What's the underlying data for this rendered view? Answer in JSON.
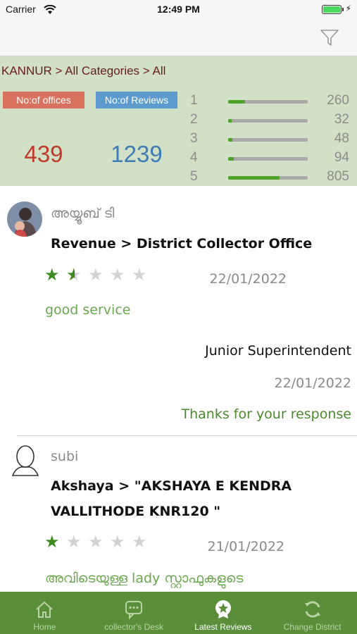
{
  "status_bar": {
    "carrier": "Carrier",
    "time": "12:49 PM"
  },
  "summary": {
    "breadcrumb": "KANNUR > All Categories > All",
    "offices_label": "No:of offices",
    "offices_count": "439",
    "reviews_label": "No:of Reviews",
    "reviews_count": "1239",
    "ratings": [
      {
        "star": "1",
        "count": "260",
        "fraction": 0.21
      },
      {
        "star": "2",
        "count": "32",
        "fraction": 0.04
      },
      {
        "star": "3",
        "count": "48",
        "fraction": 0.05
      },
      {
        "star": "4",
        "count": "94",
        "fraction": 0.07
      },
      {
        "star": "5",
        "count": "805",
        "fraction": 0.65
      }
    ]
  },
  "reviews": [
    {
      "name": "അയ്യൂബ് ടി",
      "office": "Revenue > District Collector Office",
      "rating": 1.5,
      "date": "22/01/2022",
      "text": "good service",
      "response_author": "Junior Superintendent",
      "response_date": "22/01/2022",
      "response_text": "Thanks for your response"
    },
    {
      "name": "subi",
      "office": "Akshaya > \"AKSHAYA E KENDRA VALLITHODE KNR120 \"",
      "rating": 1,
      "date": "21/01/2022",
      "text": "അവിടെയുള്ള lady സ്റ്റാഫുകളുടെ"
    }
  ],
  "tabs": [
    {
      "label": "Home",
      "icon": "home-icon"
    },
    {
      "label": "collector's Desk",
      "icon": "chat-icon"
    },
    {
      "label": "Latest Reviews",
      "icon": "star-badge-icon",
      "active": true
    },
    {
      "label": "Change District",
      "icon": "refresh-icon"
    }
  ],
  "colors": {
    "tab_bar": "#5a8e3a",
    "summary_bg": "#d2e0c8",
    "star_filled": "#3c8a1e",
    "review_text": "#6aa84f"
  }
}
